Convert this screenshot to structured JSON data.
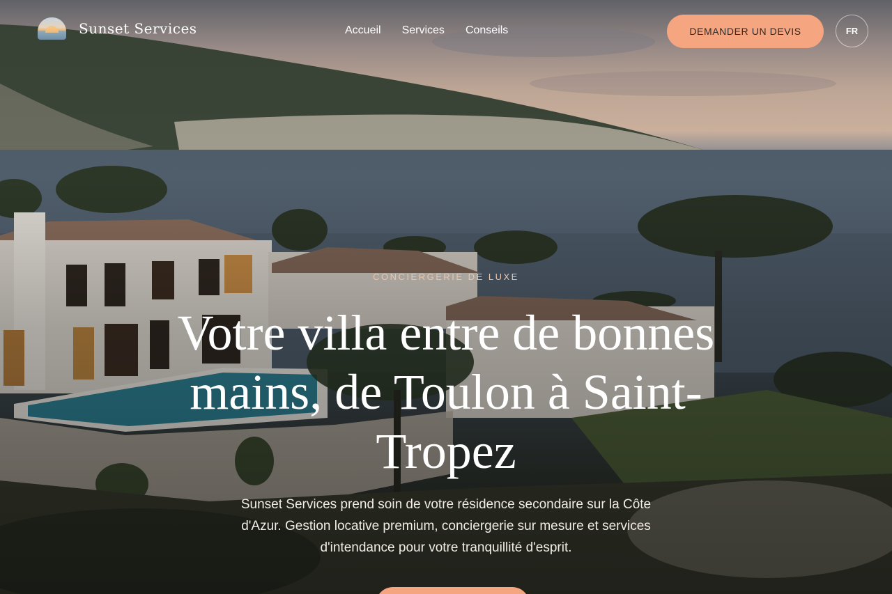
{
  "brand": {
    "name": "Sunset Services",
    "logo_icon": "sunset-logo-icon"
  },
  "nav": {
    "links": [
      "Accueil",
      "Services",
      "Conseils"
    ],
    "cta_label": "DEMANDER UN DEVIS",
    "language": "FR"
  },
  "hero": {
    "eyebrow": "CONCIERGERIE DE LUXE",
    "headline": "Votre villa entre de bonnes mains, de Toulon à Saint-Tropez",
    "description": "Sunset Services prend soin de votre résidence secondaire sur la Côte d'Azur. Gestion locative premium, conciergerie sur mesure et services d'intendance pour votre tranquillité d'esprit."
  },
  "colors": {
    "accent": "#f5a57f",
    "eyebrow": "#e9c6ae",
    "text": "#ffffff"
  }
}
